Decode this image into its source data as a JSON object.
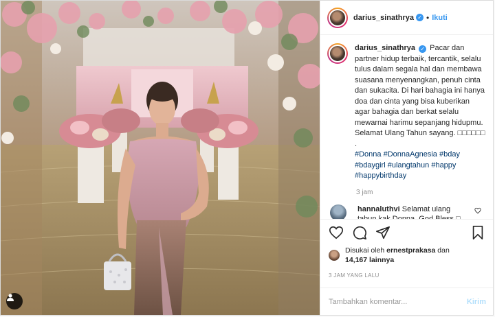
{
  "header": {
    "username": "darius_sinathrya",
    "verified_mark": "✓",
    "separator": "•",
    "follow_label": "Ikuti"
  },
  "caption": {
    "username": "darius_sinathrya",
    "text": "Pacar dan partner hidup terbaik, tercantik, selalu tulus dalam segala hal dan membawa suasana menyenangkan, penuh cinta dan sukacita. Di hari bahagia ini hanya doa dan cinta yang bisa kuberikan agar bahagia dan berkat selalu mewarnai harimu sepanjang hidupmu. Selamat Ulang Tahun sayang. □□□□□□",
    "dot": ".",
    "hashtags": [
      "#Donna",
      "#DonnaAgnesia",
      "#bday",
      "#bdaygirl",
      "#ulangtahun",
      "#happy",
      "#happybirthday"
    ],
    "time": "3 jam"
  },
  "comment": {
    "username": "hannaluthvi",
    "text": "Selamat ulang tahun kak Donna, God Bless □"
  },
  "actions": {
    "like_icon": "heart-icon",
    "comment_icon": "comment-icon",
    "share_icon": "paper-plane-icon",
    "save_icon": "bookmark-icon"
  },
  "likes": {
    "prefix": "Disukai oleh",
    "liker": "ernestprakasa",
    "conjunction": "dan",
    "count": "14,167",
    "suffix": "lainnya"
  },
  "posted_time": "3 JAM YANG LALU",
  "comment_box": {
    "placeholder": "Tambahkan komentar...",
    "post_label": "Kirim"
  },
  "colors": {
    "link": "#3897f0",
    "hashtag": "#00376b",
    "muted": "#8e8e8e",
    "post_disabled": "#b2dffc"
  }
}
